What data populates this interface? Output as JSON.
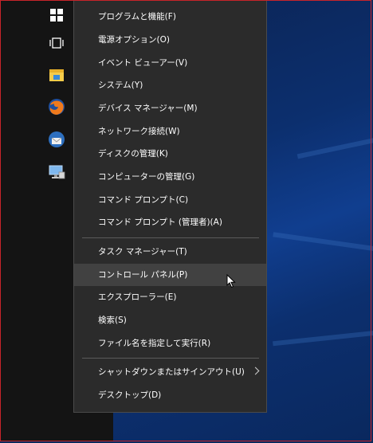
{
  "taskbar": {
    "icons": [
      "windows-logo-icon",
      "task-view-icon",
      "file-explorer-icon",
      "firefox-icon",
      "thunderbird-icon",
      "this-pc-icon"
    ]
  },
  "menu": {
    "items": [
      {
        "label": "プログラムと機能(F)"
      },
      {
        "label": "電源オプション(O)"
      },
      {
        "label": "イベント ビューアー(V)"
      },
      {
        "label": "システム(Y)"
      },
      {
        "label": "デバイス マネージャー(M)"
      },
      {
        "label": "ネットワーク接続(W)"
      },
      {
        "label": "ディスクの管理(K)"
      },
      {
        "label": "コンピューターの管理(G)"
      },
      {
        "label": "コマンド プロンプト(C)"
      },
      {
        "label": "コマンド プロンプト (管理者)(A)"
      },
      {
        "label": "タスク マネージャー(T)"
      },
      {
        "label": "コントロール パネル(P)",
        "highlighted": true
      },
      {
        "label": "エクスプローラー(E)"
      },
      {
        "label": "検索(S)"
      },
      {
        "label": "ファイル名を指定して実行(R)"
      },
      {
        "label": "シャットダウンまたはサインアウト(U)",
        "submenu": true
      },
      {
        "label": "デスクトップ(D)"
      }
    ]
  },
  "colors": {
    "menu_bg": "#2b2b2b",
    "highlight_bg": "#414141",
    "border_accent": "#c8242a"
  }
}
